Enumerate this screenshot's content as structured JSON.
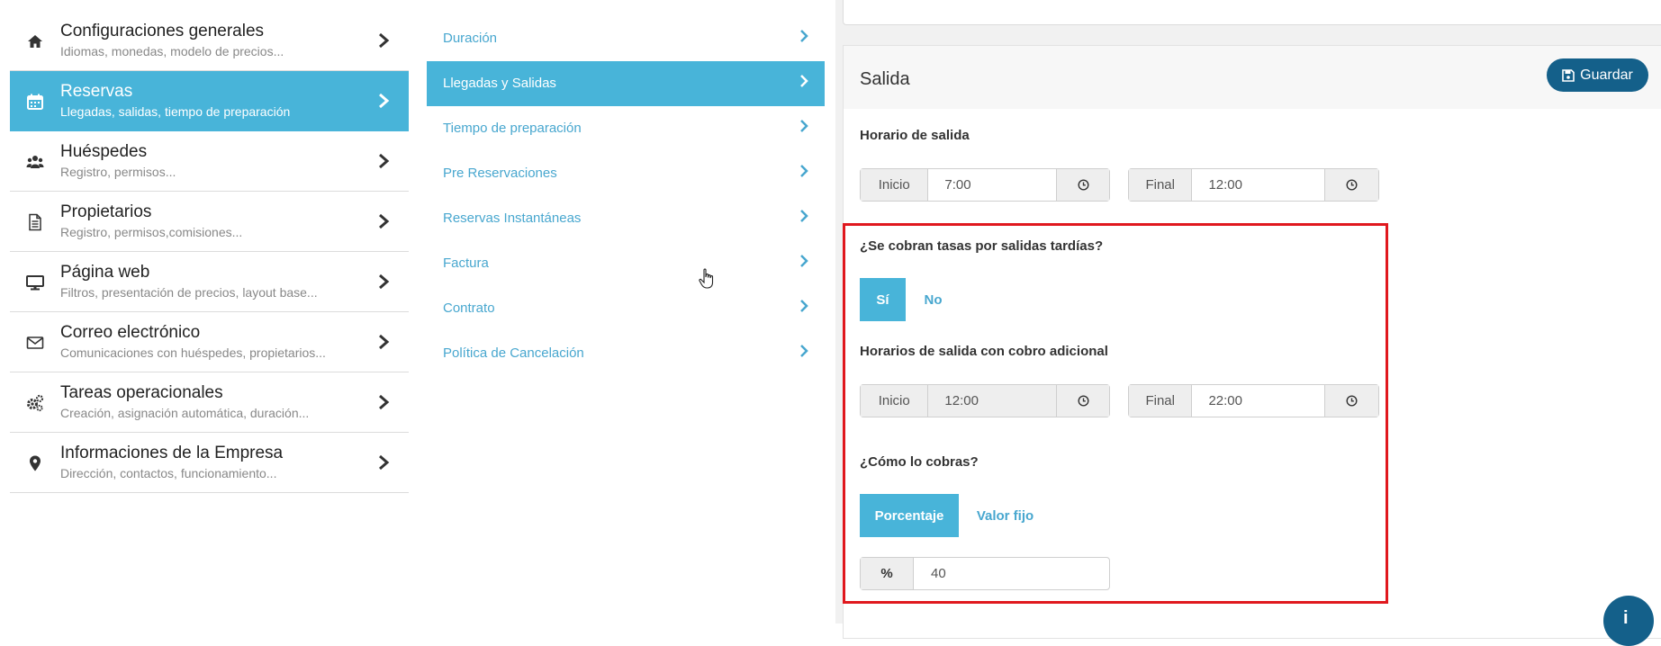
{
  "left_menu": [
    {
      "title": "Configuraciones generales",
      "subtitle": "Idiomas, monedas, modelo de precios...",
      "icon": "home-icon"
    },
    {
      "title": "Reservas",
      "subtitle": "Llegadas, salidas, tiempo de preparación",
      "icon": "calendar-icon",
      "active": true
    },
    {
      "title": "Huéspedes",
      "subtitle": "Registro, permisos...",
      "icon": "users-icon"
    },
    {
      "title": "Propietarios",
      "subtitle": "Registro, permisos,comisiones...",
      "icon": "document-icon"
    },
    {
      "title": "Página web",
      "subtitle": "Filtros, presentación de precios, layout base...",
      "icon": "monitor-icon"
    },
    {
      "title": "Correo electrónico",
      "subtitle": "Comunicaciones con huéspedes, propietarios...",
      "icon": "envelope-icon"
    },
    {
      "title": "Tareas operacionales",
      "subtitle": "Creación, asignación automática, duración...",
      "icon": "gears-icon"
    },
    {
      "title": "Informaciones de la Empresa",
      "subtitle": "Dirección, contactos, funcionamiento...",
      "icon": "map-pin-icon"
    }
  ],
  "mid_menu": [
    {
      "label": "Duración"
    },
    {
      "label": "Llegadas y Salidas",
      "active": true
    },
    {
      "label": "Tiempo de preparación"
    },
    {
      "label": "Pre Reservaciones"
    },
    {
      "label": "Reservas Instantáneas"
    },
    {
      "label": "Factura"
    },
    {
      "label": "Contrato"
    },
    {
      "label": "Política de Cancelación"
    }
  ],
  "panel": {
    "title": "Salida",
    "save_label": "Guardar",
    "checkout_hours_label": "Horario de salida",
    "start_addon": "Inicio",
    "end_addon": "Final",
    "checkout_start": "7:00",
    "checkout_end": "12:00",
    "late_fee_question": "¿Se cobran tasas por salidas tardías?",
    "yes_label": "Sí",
    "no_label": "No",
    "extra_hours_label": "Horarios de salida con cobro adicional",
    "extra_start": "12:00",
    "extra_end": "22:00",
    "charge_question": "¿Cómo lo cobras?",
    "percent_label": "Porcentaje",
    "fixed_label": "Valor fijo",
    "percent_addon": "%",
    "percent_value": "40"
  },
  "info_button": "i",
  "colors": {
    "accent": "#48b4d9",
    "primary_dark": "#14608a",
    "highlight": "#e0181e"
  }
}
